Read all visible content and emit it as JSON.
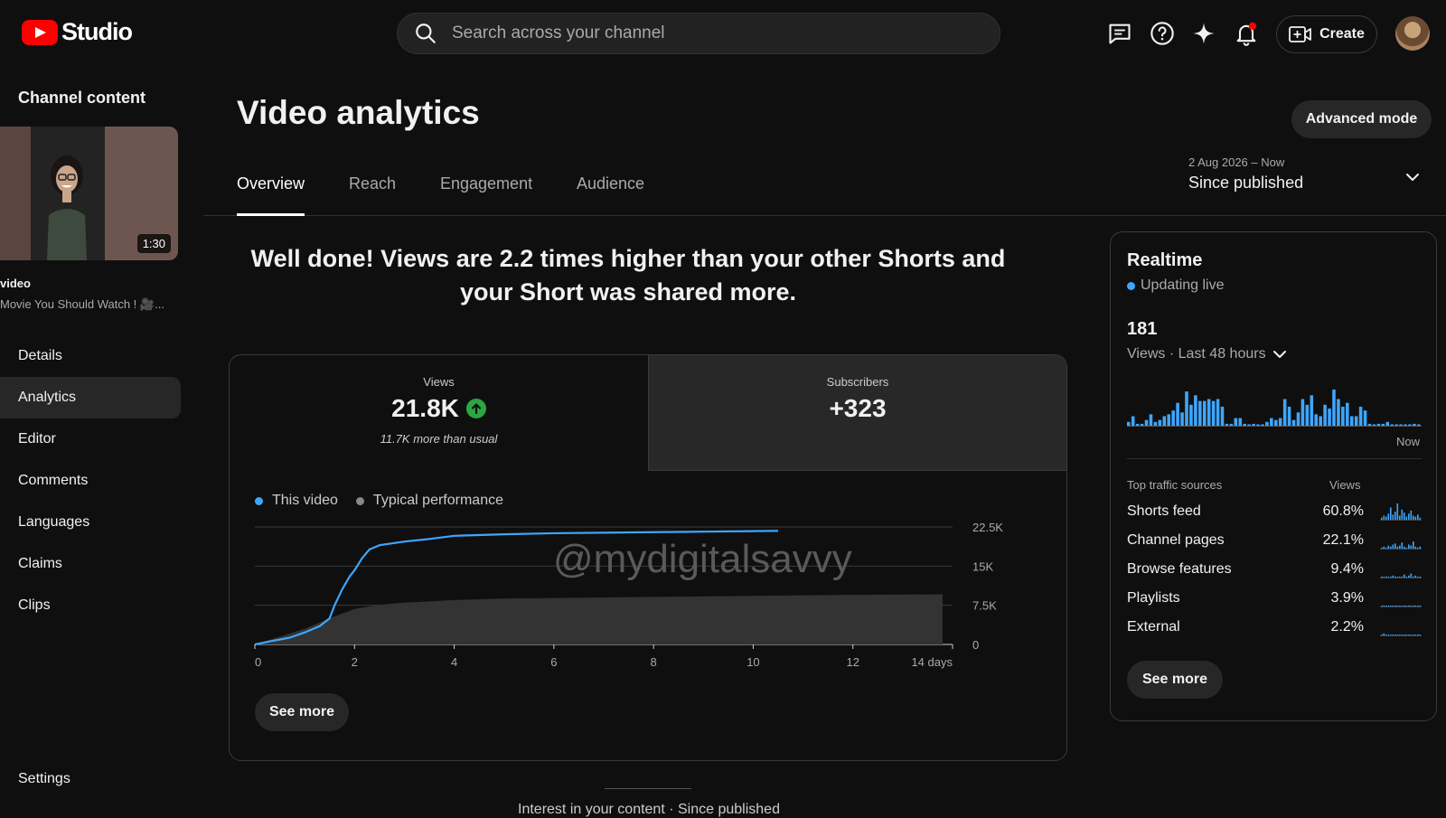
{
  "app": {
    "logo_text": "Studio"
  },
  "search": {
    "placeholder": "Search across your channel"
  },
  "topbar": {
    "create_label": "Create"
  },
  "sidebar": {
    "title": "Channel content",
    "video_duration": "1:30",
    "video_label": "video",
    "video_title": "Movie You Should Watch ! 🎥...",
    "items": [
      {
        "label": "Details"
      },
      {
        "label": "Analytics"
      },
      {
        "label": "Editor"
      },
      {
        "label": "Comments"
      },
      {
        "label": "Languages"
      },
      {
        "label": "Claims"
      },
      {
        "label": "Clips"
      }
    ],
    "settings_label": "Settings"
  },
  "main": {
    "title": "Video analytics",
    "advanced_mode_label": "Advanced mode",
    "tabs": [
      {
        "label": "Overview"
      },
      {
        "label": "Reach"
      },
      {
        "label": "Engagement"
      },
      {
        "label": "Audience"
      }
    ],
    "range_dates": "2 Aug 2026 – Now",
    "range_label": "Since published",
    "headline": "Well done! Views are 2.2 times higher than your other Shorts and your Short was shared more.",
    "views": {
      "label": "Views",
      "value": "21.8K",
      "note": "11.7K more than usual"
    },
    "subscribers": {
      "label": "Subscribers",
      "value": "+323"
    },
    "legend_this": "This video",
    "legend_typical": "Typical performance",
    "watermark": "@mydigitalsavvy",
    "see_more_label": "See more",
    "bottom_text": "Interest in your content · Since published"
  },
  "colors": {
    "accent_blue": "#3ea6ff",
    "typical_gray": "#3a3a3a",
    "up_green": "#2ba640",
    "brand_red": "#ff0000"
  },
  "chart_data": {
    "type": "line",
    "x_ticks": [
      "0",
      "2",
      "4",
      "6",
      "8",
      "10",
      "12",
      "14 days"
    ],
    "y_ticks": [
      "0",
      "7.5K",
      "15K",
      "22.5K"
    ],
    "ylim": [
      0,
      22500
    ],
    "xlim": [
      0,
      14
    ],
    "series": [
      {
        "name": "This video",
        "x": [
          0,
          0.3,
          0.7,
          1.0,
          1.3,
          1.5,
          1.6,
          1.75,
          1.9,
          2.0,
          2.15,
          2.3,
          2.5,
          3.0,
          3.5,
          4.0,
          5.0,
          6.0,
          7.0,
          8.0,
          9.0,
          10.0,
          10.5
        ],
        "y": [
          0,
          600,
          1300,
          2300,
          3500,
          5000,
          7500,
          10500,
          13000,
          14200,
          16500,
          18200,
          19000,
          19700,
          20200,
          20800,
          21100,
          21300,
          21400,
          21500,
          21600,
          21700,
          21750
        ]
      },
      {
        "name": "Typical performance",
        "x": [
          0,
          0.5,
          1.0,
          1.5,
          2.0,
          2.5,
          3.0,
          4.0,
          5.0,
          6.0,
          8.0,
          10.0,
          12.0,
          13.8
        ],
        "y": [
          0,
          1500,
          3000,
          5000,
          6800,
          7600,
          8000,
          8500,
          8800,
          8900,
          9100,
          9300,
          9500,
          9600
        ]
      }
    ]
  },
  "realtime": {
    "title": "Realtime",
    "live_label": "Updating live",
    "views_count": "181",
    "range_label": "Views · Last 48 hours",
    "now_label": "Now",
    "bars": [
      2,
      5,
      1,
      1,
      3,
      6,
      2,
      3,
      5,
      6,
      8,
      12,
      7,
      18,
      11,
      16,
      13,
      13,
      14,
      13,
      14,
      10,
      1,
      1,
      4,
      4,
      1,
      0,
      1,
      0,
      0,
      2,
      4,
      3,
      4,
      14,
      10,
      3,
      7,
      14,
      11,
      16,
      6,
      5,
      11,
      9,
      19,
      14,
      10,
      12,
      5,
      5,
      10,
      8,
      1,
      0,
      1,
      1,
      2,
      0,
      0,
      0,
      0,
      0,
      1,
      0
    ],
    "traffic_header": "Top traffic sources",
    "traffic_views_header": "Views",
    "traffic_sources": [
      {
        "name": "Shorts feed",
        "percent": "60.8%",
        "spark": [
          2,
          4,
          3,
          6,
          12,
          5,
          8,
          16,
          4,
          10,
          7,
          3,
          6,
          9,
          4,
          3,
          5,
          2
        ]
      },
      {
        "name": "Channel pages",
        "percent": "22.1%",
        "spark": [
          1,
          2,
          1,
          3,
          2,
          4,
          5,
          2,
          3,
          6,
          2,
          1,
          4,
          3,
          7,
          2,
          1,
          2
        ]
      },
      {
        "name": "Browse features",
        "percent": "9.4%",
        "spark": [
          1,
          0,
          1,
          0,
          1,
          2,
          1,
          0,
          1,
          1,
          3,
          0,
          2,
          4,
          1,
          2,
          0,
          1
        ]
      },
      {
        "name": "Playlists",
        "percent": "3.9%",
        "spark": [
          0,
          1,
          0,
          1,
          0,
          1,
          1,
          0,
          1,
          0,
          1,
          0,
          1,
          1,
          0,
          1,
          0,
          1
        ]
      },
      {
        "name": "External",
        "percent": "2.2%",
        "spark": [
          0,
          2,
          0,
          0,
          0,
          1,
          0,
          0,
          0,
          0,
          0,
          1,
          0,
          0,
          0,
          0,
          1,
          0
        ]
      }
    ]
  }
}
